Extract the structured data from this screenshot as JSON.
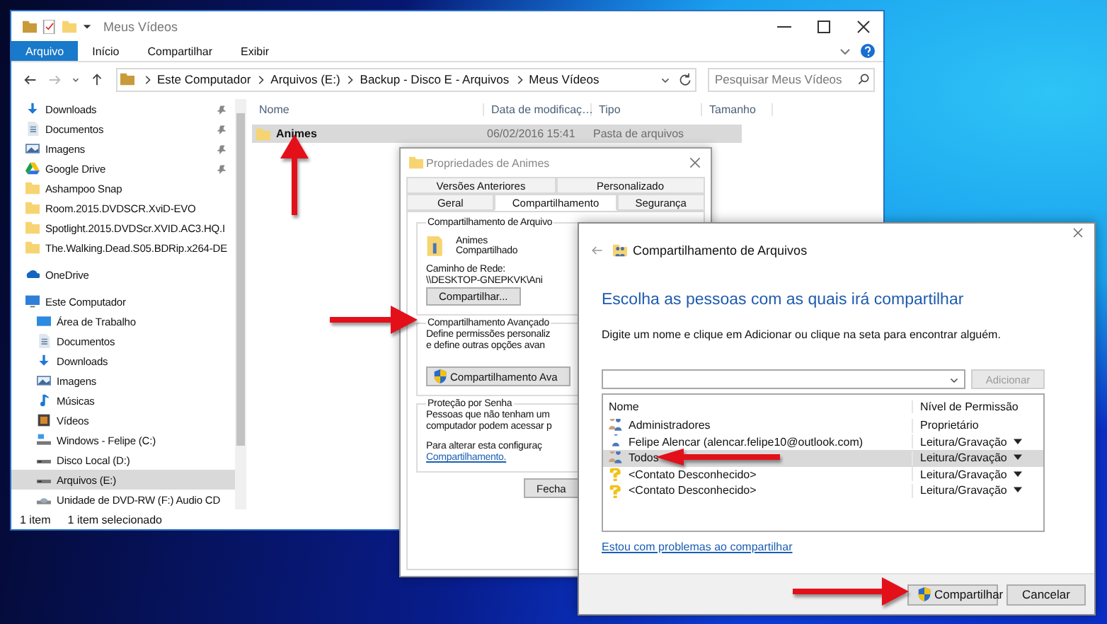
{
  "explorer": {
    "title": "Meus Vídeos",
    "ribbon_tabs": [
      {
        "label": "Arquivo",
        "kind": "file"
      },
      {
        "label": "Início",
        "kind": "tab"
      },
      {
        "label": "Compartilhar",
        "kind": "tab"
      },
      {
        "label": "Exibir",
        "kind": "tab"
      }
    ],
    "breadcrumb": [
      "Este Computador",
      "Arquivos (E:)",
      "Backup - Disco E - Arquivos",
      "Meus Vídeos"
    ],
    "search": {
      "placeholder": "Pesquisar Meus Vídeos"
    },
    "sidebar": {
      "items": [
        {
          "label": "Downloads",
          "kind": "download",
          "pinned": true,
          "selected": false
        },
        {
          "label": "Documentos",
          "kind": "document",
          "pinned": true,
          "selected": false
        },
        {
          "label": "Imagens",
          "kind": "image",
          "pinned": true,
          "selected": false
        },
        {
          "label": "Google Drive",
          "kind": "gdrive",
          "pinned": true,
          "selected": false
        },
        {
          "label": "Ashampoo Snap",
          "kind": "folder",
          "pinned": false,
          "selected": false
        },
        {
          "label": "Room.2015.DVDSCR.XviD-EVO",
          "kind": "folder",
          "pinned": false,
          "selected": false
        },
        {
          "label": "Spotlight.2015.DVDScr.XVID.AC3.HQ.I",
          "kind": "folder",
          "pinned": false,
          "selected": false
        },
        {
          "label": "The.Walking.Dead.S05.BDRip.x264-DE",
          "kind": "folder",
          "pinned": false,
          "selected": false
        },
        {
          "label": "OneDrive",
          "kind": "cloud",
          "pinned": false,
          "selected": false
        },
        {
          "label": "Este Computador",
          "kind": "computer",
          "pinned": false,
          "selected": false,
          "children": [
            {
              "label": "Área de Trabalho",
              "kind": "desktop",
              "pinned": false,
              "selected": false
            },
            {
              "label": "Documentos",
              "kind": "document",
              "pinned": false,
              "selected": false
            },
            {
              "label": "Downloads",
              "kind": "download",
              "pinned": false,
              "selected": false
            },
            {
              "label": "Imagens",
              "kind": "image",
              "pinned": false,
              "selected": false
            },
            {
              "label": "Músicas",
              "kind": "music",
              "pinned": false,
              "selected": false
            },
            {
              "label": "Vídeos",
              "kind": "video",
              "pinned": false,
              "selected": false
            },
            {
              "label": "Windows - Felipe (C:)",
              "kind": "system-drive",
              "pinned": false,
              "selected": false
            },
            {
              "label": "Disco Local (D:)",
              "kind": "drive",
              "pinned": false,
              "selected": false
            },
            {
              "label": "Arquivos (E:)",
              "kind": "drive",
              "pinned": false,
              "selected": true
            },
            {
              "label": "Unidade de DVD-RW (F:) Audio CD",
              "kind": "dvd",
              "pinned": false,
              "selected": false
            }
          ]
        }
      ]
    },
    "file_list": {
      "columns": [
        "Nome",
        "Data de modificaç…",
        "Tipo",
        "Tamanho"
      ],
      "rows": [
        {
          "name": "Animes",
          "date": "06/02/2016 15:41",
          "type": "Pasta de arquivos",
          "selected": true
        }
      ]
    },
    "status_bar": [
      "1 item",
      "1 item selecionado"
    ]
  },
  "properties": {
    "title": "Propriedades de Animes",
    "tab_rows": [
      [
        {
          "label": "Versões Anteriores",
          "selected": false
        },
        {
          "label": "Personalizado",
          "selected": false
        }
      ],
      [
        {
          "label": "Geral",
          "selected": false
        },
        {
          "label": "Compartilhamento",
          "selected": true
        },
        {
          "label": "Segurança",
          "selected": false
        }
      ]
    ],
    "sharing_group": {
      "legend": "Compartilhamento de Arquivo",
      "name": "Animes",
      "status": "Compartilhado",
      "path_label": "Caminho de Rede:",
      "path": "\\\\DESKTOP-GNEPKVK\\Ani",
      "button": "Compartilhar..."
    },
    "advanced_group": {
      "legend": "Compartilhamento Avançado",
      "lines": [
        "Define permissões personaliz",
        "e define outras opções avan"
      ],
      "button": "Compartilhamento Ava"
    },
    "password_group": {
      "legend": "Proteção por Senha",
      "lines": [
        "Pessoas que não tenham um",
        "computador podem acessar p"
      ],
      "note": "Para alterar esta configuraç",
      "link": "Compartilhamento."
    },
    "close_button": "Fecha"
  },
  "sharing": {
    "title": "Compartilhamento de Arquivos",
    "heading": "Escolha as pessoas com as quais irá compartilhar",
    "instruction": "Digite um nome e clique em Adicionar ou clique na seta para encontrar alguém.",
    "add_button": {
      "label": "Adicionar",
      "disabled": true
    },
    "columns": [
      "Nome",
      "Nível de Permissão"
    ],
    "rows": [
      {
        "name": "Administradores",
        "permission": "Proprietário",
        "kind": "group",
        "dropdown": false,
        "selected": false
      },
      {
        "name": "Felipe Alencar (alencar.felipe10@outlook.com)",
        "permission": "Leitura/Gravação",
        "kind": "user",
        "dropdown": true,
        "selected": false
      },
      {
        "name": "Todos",
        "permission": "Leitura/Gravação",
        "kind": "group",
        "dropdown": true,
        "selected": true
      },
      {
        "name": "<Contato Desconhecido>",
        "permission": "Leitura/Gravação",
        "kind": "unknown",
        "dropdown": true,
        "selected": false
      },
      {
        "name": "<Contato Desconhecido>",
        "permission": "Leitura/Gravação",
        "kind": "unknown",
        "dropdown": true,
        "selected": false
      }
    ],
    "help_link": "Estou com problemas ao compartilhar",
    "buttons": [
      {
        "label": "Compartilhar",
        "kind": "shield"
      },
      {
        "label": "Cancelar",
        "kind": "plain"
      }
    ]
  }
}
